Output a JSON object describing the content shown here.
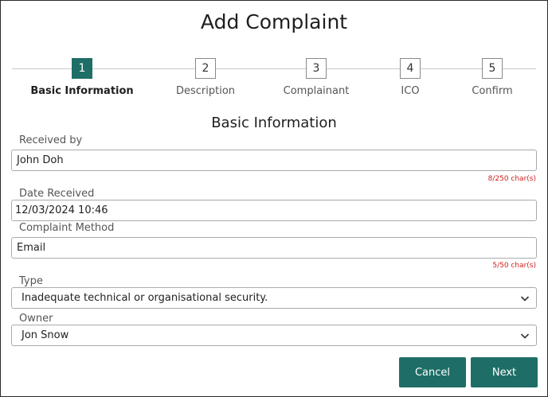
{
  "dialog": {
    "title": "Add Complaint"
  },
  "stepper": {
    "steps": [
      {
        "number": "1",
        "label": "Basic Information",
        "active": true
      },
      {
        "number": "2",
        "label": "Description",
        "active": false
      },
      {
        "number": "3",
        "label": "Complainant",
        "active": false
      },
      {
        "number": "4",
        "label": "ICO",
        "active": false
      },
      {
        "number": "5",
        "label": "Confirm",
        "active": false
      }
    ]
  },
  "section": {
    "heading": "Basic Information"
  },
  "form": {
    "received_by": {
      "label": "Received by",
      "value": "John Doh",
      "counter": "8/250 char(s)"
    },
    "date_received": {
      "label": "Date Received",
      "value": "12/03/2024 10:46"
    },
    "complaint_method": {
      "label": "Complaint Method",
      "value": "Email",
      "counter": "5/50 char(s)"
    },
    "type": {
      "label": "Type",
      "value": "Inadequate technical or organisational security.",
      "icon": "chevron-down-icon"
    },
    "owner": {
      "label": "Owner",
      "value": "Jon Snow",
      "icon": "chevron-down-icon"
    }
  },
  "buttons": {
    "cancel": "Cancel",
    "next": "Next"
  },
  "colors": {
    "accent": "#1e6e67",
    "error": "#d02020"
  }
}
